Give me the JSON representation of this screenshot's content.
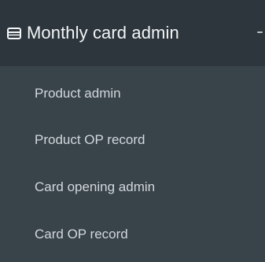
{
  "menu": {
    "title": "Monthly card admin",
    "header_icon": "card-icon",
    "collapse_icon": "collapse-icon",
    "items": [
      {
        "label": "Product admin"
      },
      {
        "label": "Product OP record"
      },
      {
        "label": "Card opening admin"
      },
      {
        "label": "Card OP record"
      }
    ]
  },
  "colors": {
    "header_bg": "#2d363d",
    "menu_bg": "#38434a",
    "header_text": "#f3f5f6",
    "item_text": "#d3d8db"
  }
}
